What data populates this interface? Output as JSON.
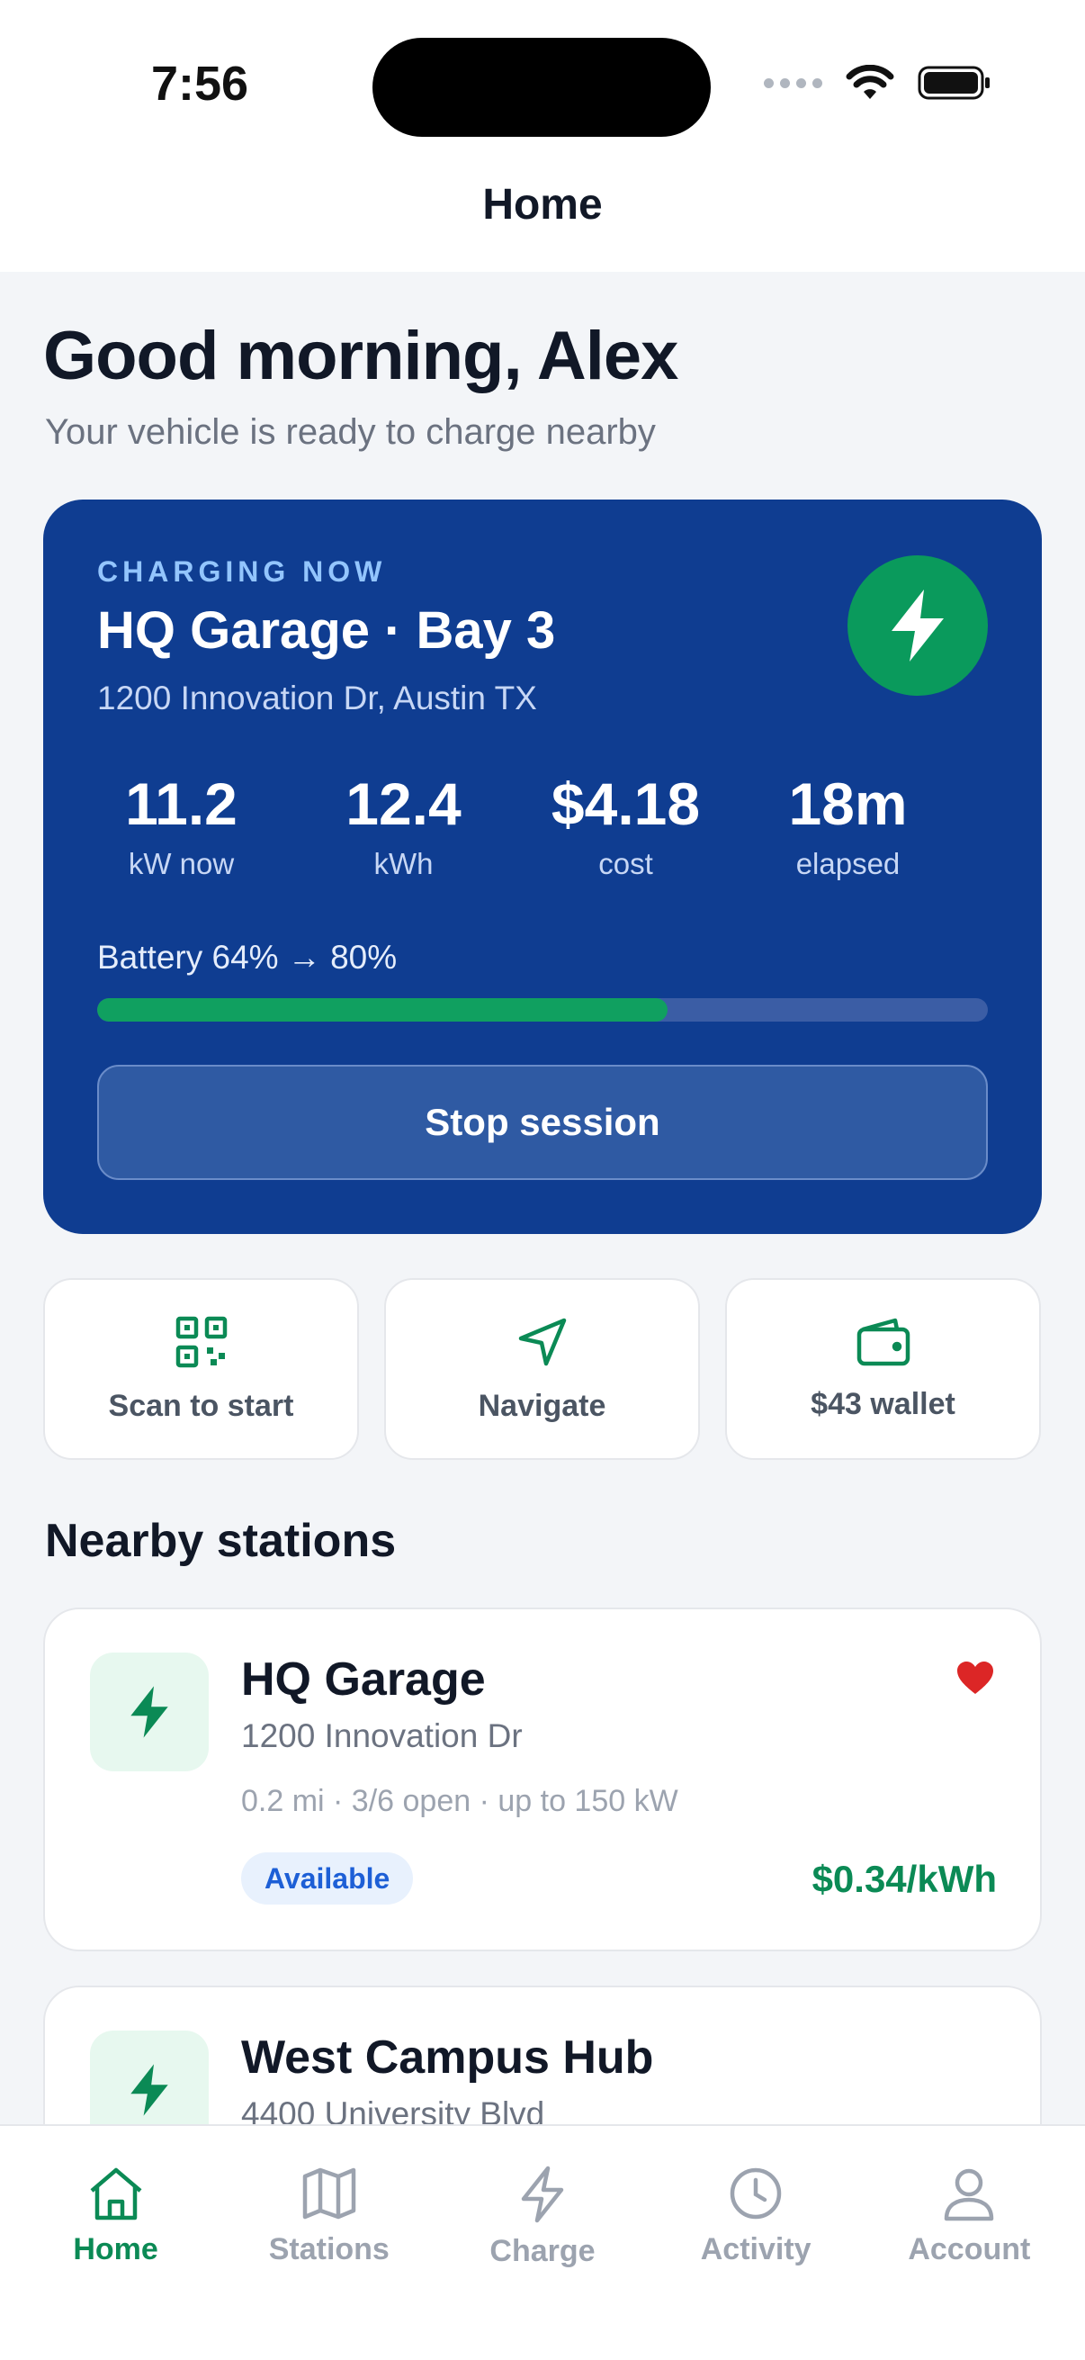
{
  "status_bar": {
    "time": "7:56"
  },
  "nav": {
    "title": "Home"
  },
  "greeting": {
    "title": "Good morning, Alex",
    "subtitle": "Your vehicle is ready to charge nearby"
  },
  "charging_session": {
    "eyebrow": "CHARGING NOW",
    "title": "HQ Garage · Bay 3",
    "address": "1200 Innovation Dr, Austin TX",
    "stats": [
      {
        "value": "11.2",
        "label": "kW now"
      },
      {
        "value": "12.4",
        "label": "kWh"
      },
      {
        "value": "$4.18",
        "label": "cost"
      },
      {
        "value": "18m",
        "label": "elapsed"
      }
    ],
    "battery_text": "Battery 64% → 80%",
    "battery_progress_percent": 64,
    "stop_label": "Stop session",
    "icon": "bolt-icon"
  },
  "quick_actions": [
    {
      "label": "Scan to start",
      "icon": "qr-code-icon"
    },
    {
      "label": "Navigate",
      "icon": "navigate-arrow-icon"
    },
    {
      "label": "$43 wallet",
      "icon": "wallet-icon"
    }
  ],
  "nearby": {
    "title": "Nearby stations",
    "stations": [
      {
        "name": "HQ Garage",
        "address": "1200 Innovation Dr",
        "meta": "0.2 mi · 3/6 open · up to 150 kW",
        "status": "Available",
        "price": "$0.34/kWh",
        "favorite": true
      },
      {
        "name": "West Campus Hub",
        "address": "4400 University Blvd"
      }
    ]
  },
  "tabs": [
    {
      "label": "Home",
      "icon": "home-icon",
      "active": true
    },
    {
      "label": "Stations",
      "icon": "map-icon",
      "active": false
    },
    {
      "label": "Charge",
      "icon": "bolt-icon",
      "active": false
    },
    {
      "label": "Activity",
      "icon": "clock-icon",
      "active": false
    },
    {
      "label": "Account",
      "icon": "user-icon",
      "active": false
    }
  ],
  "colors": {
    "primary_green": "#0b8a55",
    "card_blue": "#0f3d91",
    "favorite_red": "#dc2626",
    "badge_blue": "#1d5fd6"
  }
}
